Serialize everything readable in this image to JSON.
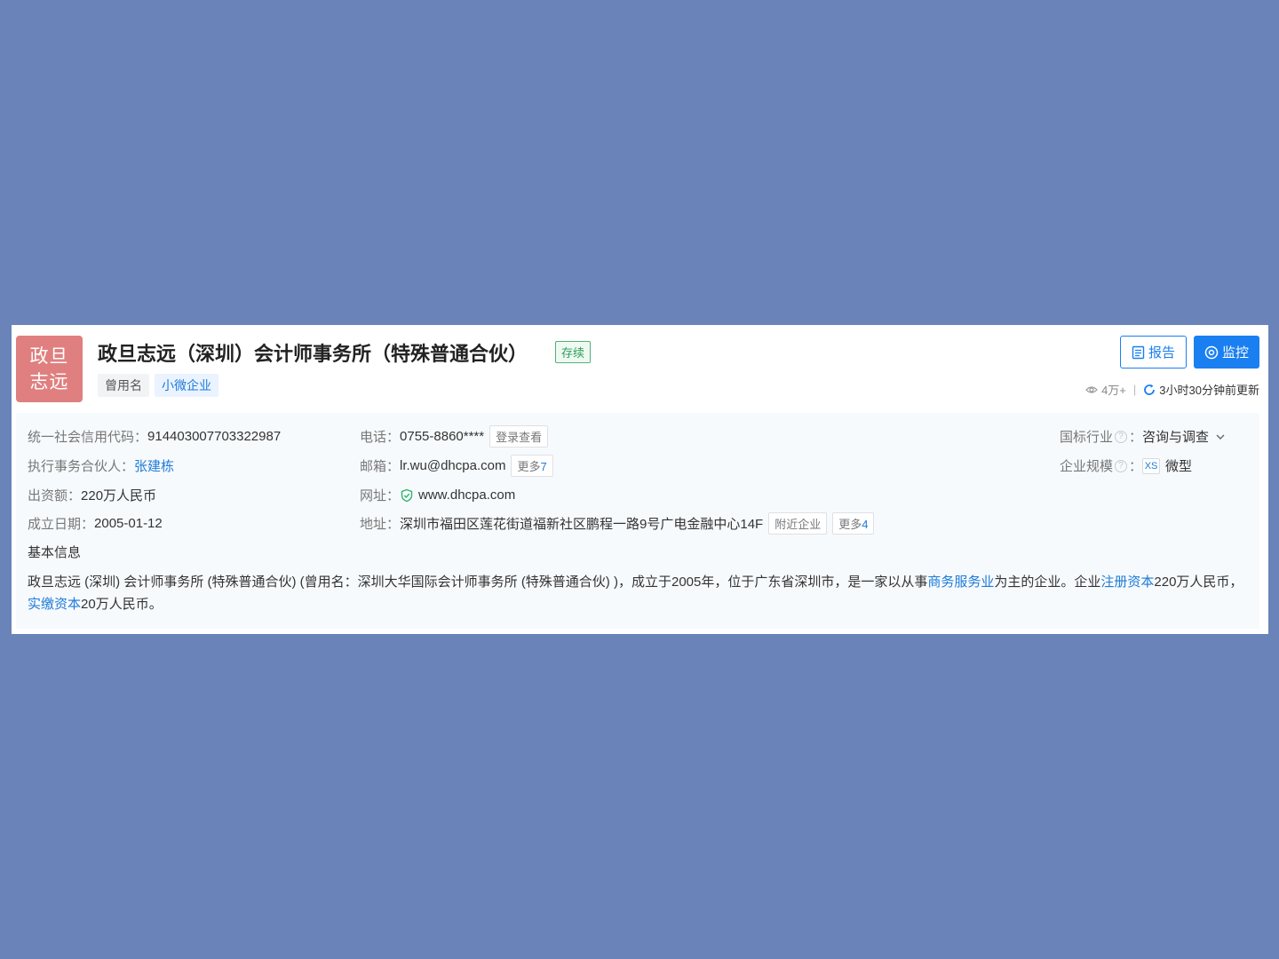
{
  "logo": {
    "line1": "政旦",
    "line2": "志远",
    "bg_color": "#e07f7f"
  },
  "company": {
    "name": "政旦志远（深圳）会计师事务所（特殊普通合伙）",
    "status": "存续",
    "tag_former_name": "曾用名",
    "tag_type": "小微企业"
  },
  "actions": {
    "report_label": "报告",
    "monitor_label": "监控",
    "accent_color": "#1a7ff0"
  },
  "meta": {
    "views": "4万+",
    "separator": "|",
    "updated": "3小时30分钟前更新"
  },
  "info": {
    "credit_code_label": "统一社会信用代码：",
    "credit_code": "914403007703322987",
    "partner_label": "执行事务合伙人：",
    "partner": "张建栋",
    "capital_label": "出资额：",
    "capital": "220万人民币",
    "date_label": "成立日期：",
    "date": "2005-01-12",
    "phone_label": "电话：",
    "phone": "0755-8860****",
    "phone_btn": "登录查看",
    "email_label": "邮箱：",
    "email": "lr.wu@dhcpa.com",
    "email_more": "更多",
    "email_more_count": "7",
    "website_label": "网址：",
    "website": "www.dhcpa.com",
    "address_label": "地址：",
    "address": "深圳市福田区莲花街道福新社区鹏程一路9号广电金融中心14F",
    "nearby_btn": "附近企业",
    "address_more": "更多",
    "address_more_count": "4",
    "industry_label": "国标行业",
    "industry": "咨询与调查",
    "scale_label": "企业规模",
    "scale_badge": "XS",
    "scale": "微型",
    "colon": "："
  },
  "basic_info_title": "基本信息",
  "description": {
    "part1": "政旦志远 (深圳) 会计师事务所 (特殊普通合伙) (曾用名：深圳大华国际会计师事务所 (特殊普通合伙) )，成立于2005年，位于广东省深圳市，是一家以从事",
    "link1": "商务服务业",
    "part2": "为主的企业。企业",
    "link2": "注册资本",
    "part3": "220万人民币，",
    "link3": "实缴资本",
    "part4": "20万人民币。"
  }
}
